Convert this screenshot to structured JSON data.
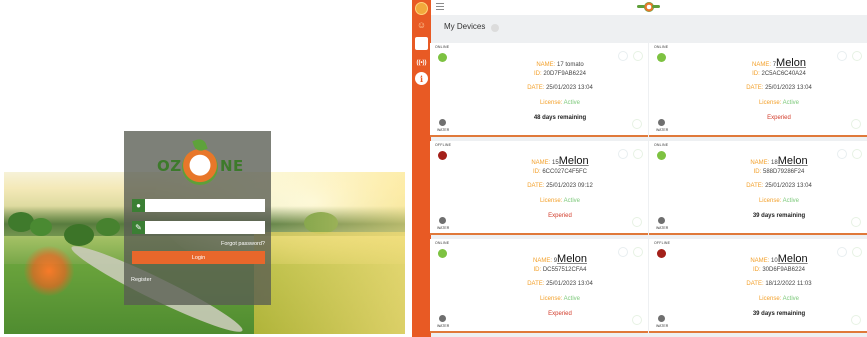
{
  "login": {
    "logo_left": "OZ",
    "logo_right": "NE",
    "username_value": "",
    "password_value": "",
    "forgot_label": "Forgot password?",
    "login_label": "Login",
    "register_label": "Register"
  },
  "dashboard": {
    "title": "My Devices",
    "colors": {
      "sidebar": "#e85a24",
      "online": "#7dc241",
      "offline": "#a3201a",
      "expired": "#d23b2a",
      "active": "#7cc87a",
      "label": "#f3a02a"
    },
    "devices": [
      {
        "status": "ONLINE",
        "name_label": "NAME:",
        "name_small": "17 tomato",
        "name_big": "",
        "id_label": "ID:",
        "id": "20D7F9AB6224",
        "date_label": "DATE:",
        "date": "25/01/2023 13:04",
        "license_label": "License:",
        "license": "Active",
        "remaining": "48 days remaining",
        "expired": false,
        "water": "WATER"
      },
      {
        "status": "ONLINE",
        "name_label": "NAME:",
        "name_small": "7",
        "name_big": "Melon",
        "id_label": "ID:",
        "id": "2C5AC6C40A24",
        "date_label": "DATE:",
        "date": "25/01/2023 13:04",
        "license_label": "License:",
        "license": "Active",
        "remaining": "Experied",
        "expired": true,
        "water": "WATER"
      },
      {
        "status": "OFFLINE",
        "name_label": "NAME:",
        "name_small": "15",
        "name_big": "Melon",
        "id_label": "ID:",
        "id": "6CC027C4F5FC",
        "date_label": "DATE:",
        "date": "25/01/2023 09:12",
        "license_label": "License:",
        "license": "Active",
        "remaining": "Experied",
        "expired": true,
        "water": "WATER"
      },
      {
        "status": "ONLINE",
        "name_label": "NAME:",
        "name_small": "18",
        "name_big": "Melon",
        "id_label": "ID:",
        "id": "588D79286F24",
        "date_label": "DATE:",
        "date": "25/01/2023 13:04",
        "license_label": "License:",
        "license": "Active",
        "remaining": "39 days remaining",
        "expired": false,
        "water": "WATER"
      },
      {
        "status": "ONLINE",
        "name_label": "NAME:",
        "name_small": "9",
        "name_big": "Melon",
        "id_label": "ID:",
        "id": "DC557512CFA4",
        "date_label": "DATE:",
        "date": "25/01/2023 13:04",
        "license_label": "License:",
        "license": "Active",
        "remaining": "Experied",
        "expired": true,
        "water": "WATER"
      },
      {
        "status": "OFFLINE",
        "name_label": "NAME:",
        "name_small": "10",
        "name_big": "Melon",
        "id_label": "ID:",
        "id": "30D6F9AB6224",
        "date_label": "DATE:",
        "date": "18/12/2022 11:03",
        "license_label": "License:",
        "license": "Active",
        "remaining": "39 days remaining",
        "expired": false,
        "water": "WATER"
      }
    ]
  }
}
